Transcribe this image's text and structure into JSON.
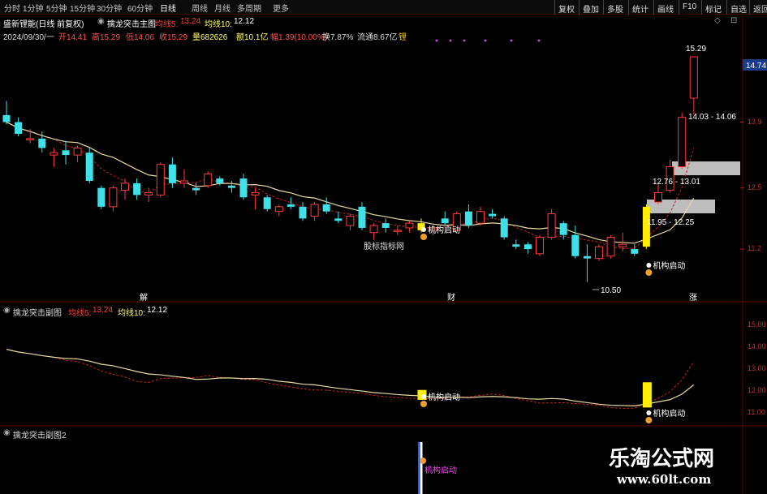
{
  "toolbar": {
    "timeframes": [
      "分时",
      "1分钟",
      "5分钟",
      "15分钟",
      "30分钟",
      "60分钟",
      "日线",
      "周线",
      "月线",
      "多周期",
      "更多"
    ],
    "active_timeframe": "日线",
    "buttons": [
      "复权",
      "叠加",
      "多股",
      "统计",
      "画线",
      "F10",
      "标记",
      "自选",
      "返回"
    ]
  },
  "header": {
    "stock": "盛新锂能(日线 前复权)",
    "indicator": "擒龙突击主图",
    "ma5_label": "均线5:",
    "ma5_value": "13.24",
    "ma10_label": "均线10:",
    "ma10_value": "12.12"
  },
  "quote": {
    "date": "2024/09/30/一",
    "open": "开14.41",
    "high": "高15.29",
    "low": "低14.06",
    "close": "收15.29",
    "volume": "量682626",
    "amount": "额10.1亿",
    "change": "幅1.39(10.00%)",
    "turnover": "换7.87%",
    "float": "流通8.67亿",
    "extra": "锂"
  },
  "price_axis": [
    "13.9",
    "12.5",
    "11.2"
  ],
  "current_price": "14.74",
  "annotations": {
    "high": "15.29",
    "low": "10.50",
    "zone_top": "14.03 - 14.06",
    "zone_mid": "12.76 - 13.01",
    "zone_low": "11.95 - 12.25",
    "signal": "机构启动",
    "signal_label": "股标指标网",
    "marker_left": "解",
    "marker_mid": "财",
    "marker_right": "涨"
  },
  "sub1": {
    "title": "擒龙突击副图",
    "ma5_label": "均线5:",
    "ma5_value": "13.24",
    "ma10_label": "均线10:",
    "ma10_value": "12.12",
    "axis": [
      "15.00",
      "14.00",
      "13.00",
      "12.00",
      "11.00"
    ],
    "signal": "机构启动"
  },
  "sub2": {
    "title": "擒龙突击副图2",
    "signal": "机构启动"
  },
  "watermark": {
    "title": "乐淘公式网",
    "url": "www.60lt.com"
  },
  "colors": {
    "up": "#ff3b3b",
    "down": "#3fe0e8",
    "ma": "#e8dca0",
    "signal": "#ffee00",
    "zone": "#bdbdbd"
  },
  "chart_data": {
    "type": "candlestick",
    "y_range": [
      10.2,
      15.6
    ],
    "candles": [
      {
        "o": 14.05,
        "h": 14.35,
        "l": 13.85,
        "c": 13.9
      },
      {
        "o": 13.9,
        "h": 14.0,
        "l": 13.6,
        "c": 13.65
      },
      {
        "o": 13.55,
        "h": 13.75,
        "l": 13.45,
        "c": 13.55
      },
      {
        "o": 13.55,
        "h": 13.7,
        "l": 13.25,
        "c": 13.35
      },
      {
        "o": 13.2,
        "h": 13.35,
        "l": 12.95,
        "c": 13.25
      },
      {
        "o": 13.3,
        "h": 13.5,
        "l": 13.0,
        "c": 13.2
      },
      {
        "o": 13.2,
        "h": 13.4,
        "l": 13.05,
        "c": 13.35
      },
      {
        "o": 13.25,
        "h": 13.35,
        "l": 12.6,
        "c": 12.65
      },
      {
        "o": 12.5,
        "h": 12.55,
        "l": 12.05,
        "c": 12.1
      },
      {
        "o": 12.1,
        "h": 12.55,
        "l": 12.0,
        "c": 12.5
      },
      {
        "o": 12.45,
        "h": 12.7,
        "l": 12.25,
        "c": 12.6
      },
      {
        "o": 12.6,
        "h": 12.7,
        "l": 12.25,
        "c": 12.35
      },
      {
        "o": 12.35,
        "h": 12.5,
        "l": 12.2,
        "c": 12.4
      },
      {
        "o": 12.35,
        "h": 13.05,
        "l": 12.3,
        "c": 13.0
      },
      {
        "o": 13.0,
        "h": 13.15,
        "l": 12.5,
        "c": 12.6
      },
      {
        "o": 12.6,
        "h": 12.9,
        "l": 12.5,
        "c": 12.65
      },
      {
        "o": 12.5,
        "h": 12.6,
        "l": 12.35,
        "c": 12.45
      },
      {
        "o": 12.55,
        "h": 12.85,
        "l": 12.5,
        "c": 12.8
      },
      {
        "o": 12.7,
        "h": 12.75,
        "l": 12.55,
        "c": 12.6
      },
      {
        "o": 12.55,
        "h": 12.65,
        "l": 12.4,
        "c": 12.5
      },
      {
        "o": 12.7,
        "h": 12.8,
        "l": 12.25,
        "c": 12.3
      },
      {
        "o": 12.35,
        "h": 12.5,
        "l": 12.05,
        "c": 12.4
      },
      {
        "o": 12.3,
        "h": 12.35,
        "l": 12.0,
        "c": 12.05
      },
      {
        "o": 12.0,
        "h": 12.15,
        "l": 11.9,
        "c": 12.1
      },
      {
        "o": 12.15,
        "h": 12.3,
        "l": 12.05,
        "c": 12.1
      },
      {
        "o": 12.1,
        "h": 12.2,
        "l": 11.8,
        "c": 11.85
      },
      {
        "o": 11.9,
        "h": 12.2,
        "l": 11.8,
        "c": 12.15
      },
      {
        "o": 12.15,
        "h": 12.3,
        "l": 11.95,
        "c": 12.0
      },
      {
        "o": 11.85,
        "h": 12.0,
        "l": 11.75,
        "c": 11.8
      },
      {
        "o": 11.7,
        "h": 11.95,
        "l": 11.6,
        "c": 11.9
      },
      {
        "o": 12.1,
        "h": 12.2,
        "l": 11.6,
        "c": 11.65
      },
      {
        "o": 11.55,
        "h": 11.75,
        "l": 11.4,
        "c": 11.7
      },
      {
        "o": 11.75,
        "h": 11.85,
        "l": 11.55,
        "c": 11.65
      },
      {
        "o": 11.6,
        "h": 11.7,
        "l": 11.5,
        "c": 11.6
      },
      {
        "o": 11.65,
        "h": 11.8,
        "l": 11.55,
        "c": 11.75
      },
      {
        "o": 11.75,
        "h": 11.85,
        "l": 11.55,
        "c": 11.6
      },
      {
        "o": 11.6,
        "h": 11.7,
        "l": 11.5,
        "c": 11.65
      },
      {
        "o": 11.85,
        "h": 12.0,
        "l": 11.7,
        "c": 11.75
      },
      {
        "o": 11.6,
        "h": 12.0,
        "l": 11.6,
        "c": 11.95
      },
      {
        "o": 12.0,
        "h": 12.15,
        "l": 11.65,
        "c": 11.7
      },
      {
        "o": 11.75,
        "h": 12.1,
        "l": 11.7,
        "c": 12.0
      },
      {
        "o": 11.95,
        "h": 12.05,
        "l": 11.85,
        "c": 11.9
      },
      {
        "o": 11.85,
        "h": 11.9,
        "l": 11.4,
        "c": 11.45
      },
      {
        "o": 11.3,
        "h": 11.4,
        "l": 11.2,
        "c": 11.25
      },
      {
        "o": 11.3,
        "h": 11.35,
        "l": 11.1,
        "c": 11.2
      },
      {
        "o": 11.1,
        "h": 11.5,
        "l": 11.05,
        "c": 11.45
      },
      {
        "o": 11.45,
        "h": 12.05,
        "l": 11.4,
        "c": 11.95
      },
      {
        "o": 11.75,
        "h": 11.8,
        "l": 11.4,
        "c": 11.5
      },
      {
        "o": 11.5,
        "h": 11.7,
        "l": 11.0,
        "c": 11.05
      },
      {
        "o": 11.05,
        "h": 11.3,
        "l": 10.5,
        "c": 11.0
      },
      {
        "o": 11.0,
        "h": 11.3,
        "l": 10.95,
        "c": 11.25
      },
      {
        "o": 11.05,
        "h": 11.5,
        "l": 11.0,
        "c": 11.45
      },
      {
        "o": 11.25,
        "h": 11.55,
        "l": 11.15,
        "c": 11.3
      },
      {
        "o": 11.2,
        "h": 11.3,
        "l": 11.05,
        "c": 11.1
      },
      {
        "o": 11.25,
        "h": 12.15,
        "l": 11.2,
        "c": 12.1
      },
      {
        "o": 12.2,
        "h": 12.6,
        "l": 12.15,
        "c": 12.4
      },
      {
        "o": 12.45,
        "h": 13.1,
        "l": 12.4,
        "c": 12.95
      },
      {
        "o": 12.95,
        "h": 14.1,
        "l": 12.9,
        "c": 14.0
      },
      {
        "o": 14.41,
        "h": 15.29,
        "l": 14.06,
        "c": 15.29
      }
    ],
    "signal_candles": [
      35,
      54
    ],
    "signal_pointer": [
      35,
      54
    ],
    "zones": [
      {
        "label": "12.76 - 13.01",
        "low": 12.76,
        "high": 13.01
      },
      {
        "label": "11.95 - 12.25",
        "low": 11.95,
        "high": 12.25
      }
    ]
  }
}
